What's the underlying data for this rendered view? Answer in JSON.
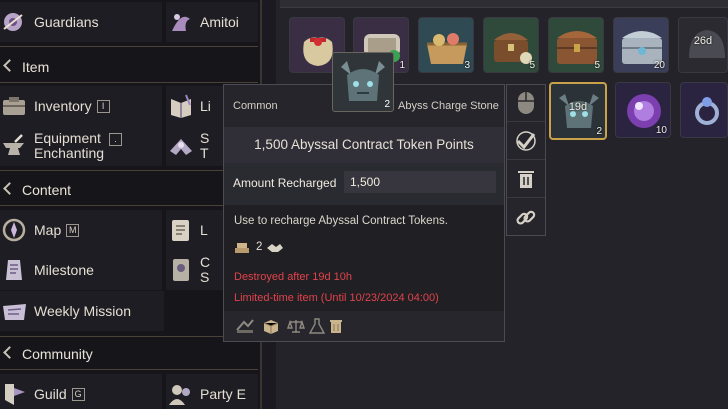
{
  "menu": {
    "rows": [
      {
        "left": {
          "label": "Guardians",
          "icon": "guardians-icon"
        },
        "right": {
          "label": "Amitoi",
          "icon": "amitoi-icon"
        }
      },
      {
        "left": {
          "label": "Inventory",
          "key": "I",
          "icon": "inventory-icon"
        },
        "right": {
          "label": "Li",
          "icon": "library-icon"
        }
      },
      {
        "left": {
          "label": "Equipment\nEnchanting",
          "key": ".",
          "icon": "anvil-icon"
        },
        "right": {
          "label": "S\nT",
          "icon": "stigma-icon"
        }
      },
      {
        "left": {
          "label": "Map",
          "key": "M",
          "icon": "map-icon"
        },
        "right": {
          "label": "L",
          "icon": "log-icon"
        }
      },
      {
        "left": {
          "label": "Milestone",
          "icon": "milestone-icon"
        },
        "right": {
          "label": "C\nS",
          "icon": "codex-icon"
        }
      },
      {
        "left": {
          "label": "Weekly Mission",
          "icon": "weekly-mission-icon"
        }
      },
      {
        "left": {
          "label": "Guild",
          "key": "G",
          "icon": "guild-icon"
        },
        "right": {
          "label": "Party E",
          "icon": "party-icon"
        }
      }
    ],
    "sections": {
      "item": "Item",
      "content": "Content",
      "community": "Community"
    }
  },
  "inventory": {
    "row1": [
      {
        "qty": "",
        "icon": "gift-sack-icon"
      },
      {
        "qty": "1",
        "icon": "scroll-icon"
      },
      {
        "qty": "3",
        "icon": "basket-icon"
      },
      {
        "qty": "5",
        "icon": "treasure-chest-icon"
      },
      {
        "qty": "5",
        "icon": "wooden-chest-icon"
      },
      {
        "qty": "20",
        "icon": "silver-chest-icon"
      },
      {
        "qty": "26d",
        "icon": "helmet-icon"
      }
    ],
    "row2": [
      {
        "qty": "2",
        "timer": "19d",
        "icon": "abyss-stone-icon"
      },
      {
        "qty": "10",
        "icon": "purple-orb-icon"
      },
      {
        "qty": "",
        "icon": "ring-icon"
      }
    ]
  },
  "tooltip": {
    "rarity": "Common",
    "item_name": "Abyss Charge Stone",
    "icon_qty": "2",
    "title": "1,500 Abyssal Contract Token Points",
    "stat_label": "Amount Recharged",
    "stat_value": "1,500",
    "description": "Use to recharge Abyssal Contract Tokens.",
    "mat_count": "2",
    "destroyed": "Destroyed after 19d 10h",
    "limited": "Limited-time item (Until 10/23/2024 04:00)"
  },
  "colors": {
    "warning": "#e2434b",
    "selected_border": "#c9a24a"
  }
}
